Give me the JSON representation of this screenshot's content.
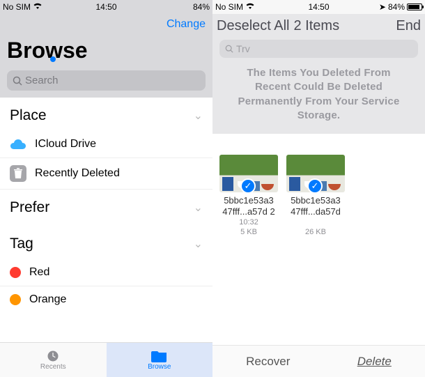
{
  "left": {
    "status": {
      "carrier": "No SIM",
      "time": "14:50",
      "battery": "84%"
    },
    "nav": {
      "change": "Change"
    },
    "title": "Browse",
    "search_placeholder": "Search",
    "sections": {
      "place": {
        "header": "Place",
        "items": [
          {
            "icon": "cloud",
            "label": "ICloud Drive"
          },
          {
            "icon": "trash",
            "label": "Recently Deleted"
          }
        ]
      },
      "prefer": {
        "header": "Prefer"
      },
      "tags": {
        "header": "Tag",
        "items": [
          {
            "color": "#ff3b30",
            "label": "Red"
          },
          {
            "color": "#ff9500",
            "label": "Orange"
          }
        ]
      }
    },
    "tabs": {
      "recents": "Recents",
      "browse": "Browse"
    }
  },
  "right": {
    "status": {
      "carrier": "No SIM",
      "time": "14:50",
      "battery": "84%"
    },
    "nav": {
      "deselect": "Deselect All",
      "count": "2 Items",
      "end": "End"
    },
    "search_placeholder": "Trv",
    "notice_l1": "The Items You Deleted From",
    "notice_l2": "Recent Could Be Deleted",
    "notice_l3": "Permanently From Your Service",
    "notice_l4": "Storage.",
    "files": [
      {
        "name_l1": "5bbc1e53a3",
        "name_l2": "47fff...a57d 2",
        "time": "10:32",
        "size": "5 KB"
      },
      {
        "name_l1": "5bbc1e53a3",
        "name_l2": "47fff...da57d",
        "time": "",
        "size": "26 KB"
      }
    ],
    "actions": {
      "recover": "Recover",
      "delete": "Delete"
    }
  }
}
